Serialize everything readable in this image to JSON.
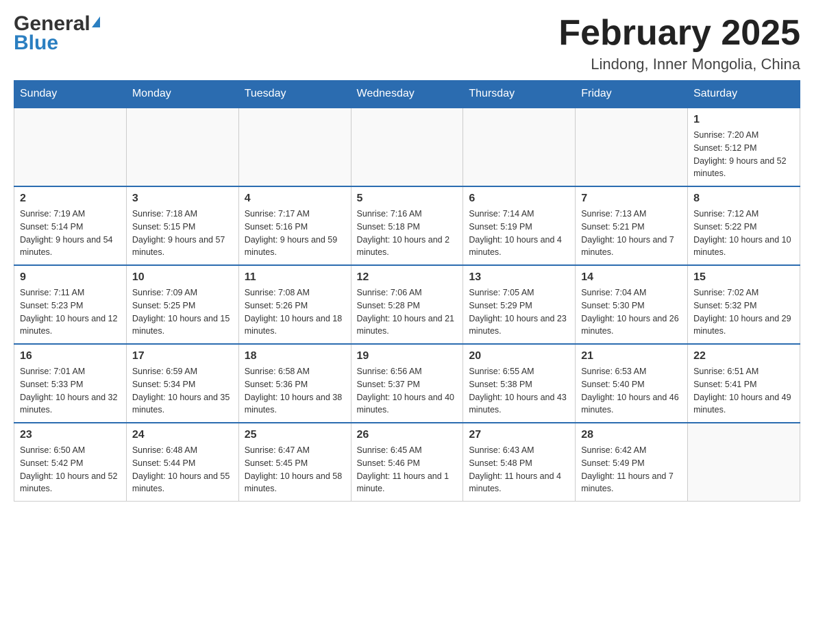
{
  "header": {
    "logo_general": "General",
    "logo_blue": "Blue",
    "month_title": "February 2025",
    "location": "Lindong, Inner Mongolia, China"
  },
  "weekdays": [
    "Sunday",
    "Monday",
    "Tuesday",
    "Wednesday",
    "Thursday",
    "Friday",
    "Saturday"
  ],
  "weeks": [
    [
      {
        "day": "",
        "info": ""
      },
      {
        "day": "",
        "info": ""
      },
      {
        "day": "",
        "info": ""
      },
      {
        "day": "",
        "info": ""
      },
      {
        "day": "",
        "info": ""
      },
      {
        "day": "",
        "info": ""
      },
      {
        "day": "1",
        "info": "Sunrise: 7:20 AM\nSunset: 5:12 PM\nDaylight: 9 hours and 52 minutes."
      }
    ],
    [
      {
        "day": "2",
        "info": "Sunrise: 7:19 AM\nSunset: 5:14 PM\nDaylight: 9 hours and 54 minutes."
      },
      {
        "day": "3",
        "info": "Sunrise: 7:18 AM\nSunset: 5:15 PM\nDaylight: 9 hours and 57 minutes."
      },
      {
        "day": "4",
        "info": "Sunrise: 7:17 AM\nSunset: 5:16 PM\nDaylight: 9 hours and 59 minutes."
      },
      {
        "day": "5",
        "info": "Sunrise: 7:16 AM\nSunset: 5:18 PM\nDaylight: 10 hours and 2 minutes."
      },
      {
        "day": "6",
        "info": "Sunrise: 7:14 AM\nSunset: 5:19 PM\nDaylight: 10 hours and 4 minutes."
      },
      {
        "day": "7",
        "info": "Sunrise: 7:13 AM\nSunset: 5:21 PM\nDaylight: 10 hours and 7 minutes."
      },
      {
        "day": "8",
        "info": "Sunrise: 7:12 AM\nSunset: 5:22 PM\nDaylight: 10 hours and 10 minutes."
      }
    ],
    [
      {
        "day": "9",
        "info": "Sunrise: 7:11 AM\nSunset: 5:23 PM\nDaylight: 10 hours and 12 minutes."
      },
      {
        "day": "10",
        "info": "Sunrise: 7:09 AM\nSunset: 5:25 PM\nDaylight: 10 hours and 15 minutes."
      },
      {
        "day": "11",
        "info": "Sunrise: 7:08 AM\nSunset: 5:26 PM\nDaylight: 10 hours and 18 minutes."
      },
      {
        "day": "12",
        "info": "Sunrise: 7:06 AM\nSunset: 5:28 PM\nDaylight: 10 hours and 21 minutes."
      },
      {
        "day": "13",
        "info": "Sunrise: 7:05 AM\nSunset: 5:29 PM\nDaylight: 10 hours and 23 minutes."
      },
      {
        "day": "14",
        "info": "Sunrise: 7:04 AM\nSunset: 5:30 PM\nDaylight: 10 hours and 26 minutes."
      },
      {
        "day": "15",
        "info": "Sunrise: 7:02 AM\nSunset: 5:32 PM\nDaylight: 10 hours and 29 minutes."
      }
    ],
    [
      {
        "day": "16",
        "info": "Sunrise: 7:01 AM\nSunset: 5:33 PM\nDaylight: 10 hours and 32 minutes."
      },
      {
        "day": "17",
        "info": "Sunrise: 6:59 AM\nSunset: 5:34 PM\nDaylight: 10 hours and 35 minutes."
      },
      {
        "day": "18",
        "info": "Sunrise: 6:58 AM\nSunset: 5:36 PM\nDaylight: 10 hours and 38 minutes."
      },
      {
        "day": "19",
        "info": "Sunrise: 6:56 AM\nSunset: 5:37 PM\nDaylight: 10 hours and 40 minutes."
      },
      {
        "day": "20",
        "info": "Sunrise: 6:55 AM\nSunset: 5:38 PM\nDaylight: 10 hours and 43 minutes."
      },
      {
        "day": "21",
        "info": "Sunrise: 6:53 AM\nSunset: 5:40 PM\nDaylight: 10 hours and 46 minutes."
      },
      {
        "day": "22",
        "info": "Sunrise: 6:51 AM\nSunset: 5:41 PM\nDaylight: 10 hours and 49 minutes."
      }
    ],
    [
      {
        "day": "23",
        "info": "Sunrise: 6:50 AM\nSunset: 5:42 PM\nDaylight: 10 hours and 52 minutes."
      },
      {
        "day": "24",
        "info": "Sunrise: 6:48 AM\nSunset: 5:44 PM\nDaylight: 10 hours and 55 minutes."
      },
      {
        "day": "25",
        "info": "Sunrise: 6:47 AM\nSunset: 5:45 PM\nDaylight: 10 hours and 58 minutes."
      },
      {
        "day": "26",
        "info": "Sunrise: 6:45 AM\nSunset: 5:46 PM\nDaylight: 11 hours and 1 minute."
      },
      {
        "day": "27",
        "info": "Sunrise: 6:43 AM\nSunset: 5:48 PM\nDaylight: 11 hours and 4 minutes."
      },
      {
        "day": "28",
        "info": "Sunrise: 6:42 AM\nSunset: 5:49 PM\nDaylight: 11 hours and 7 minutes."
      },
      {
        "day": "",
        "info": ""
      }
    ]
  ]
}
